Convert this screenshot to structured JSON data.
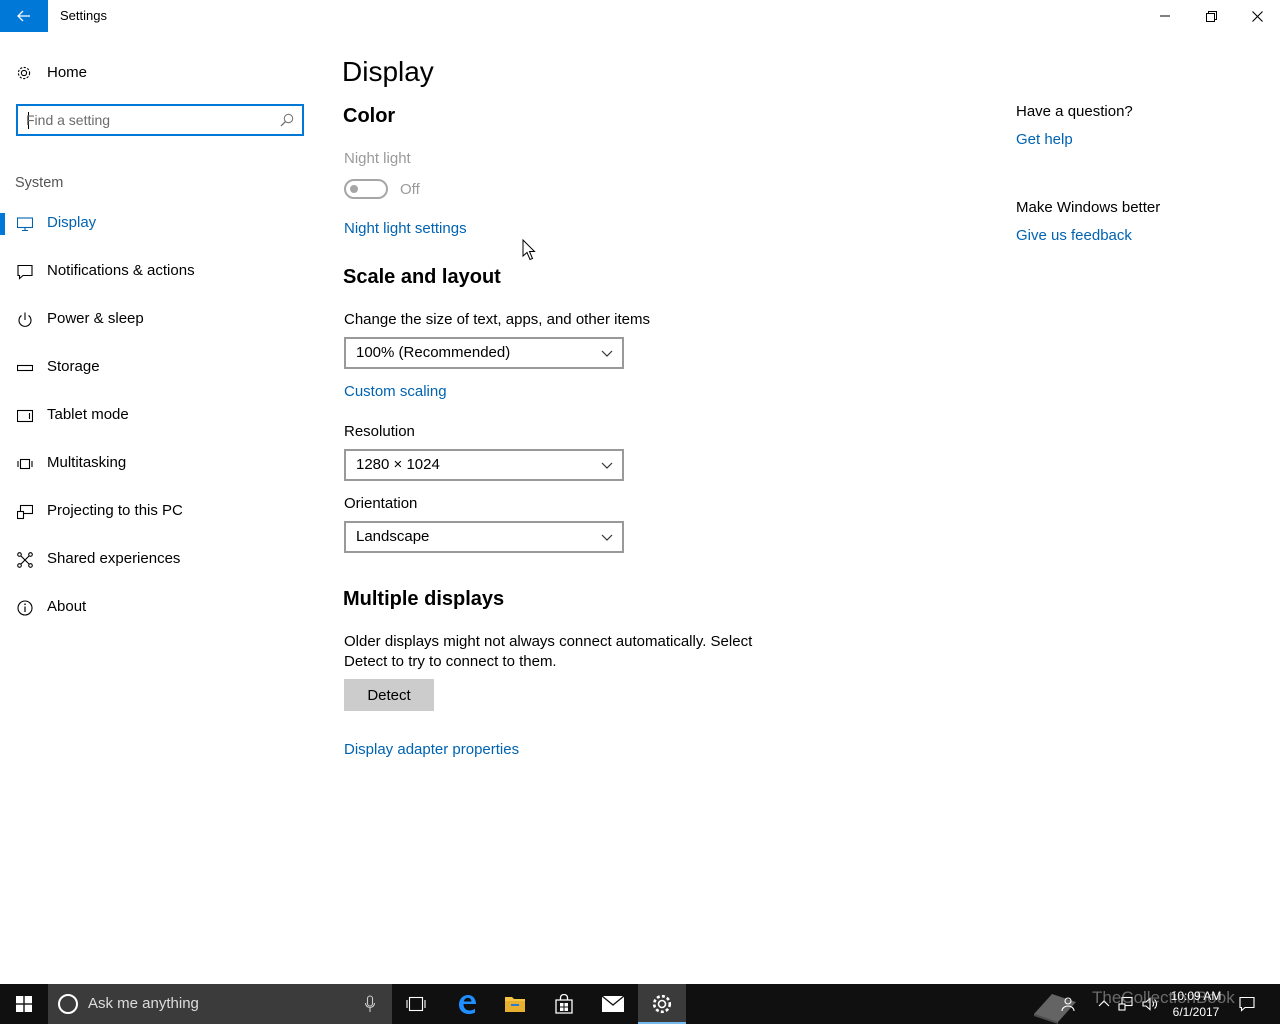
{
  "window": {
    "title": "Settings"
  },
  "sidebar": {
    "home_label": "Home",
    "search_placeholder": "Find a setting",
    "group_label": "System",
    "items": [
      {
        "label": "Display",
        "icon": "monitor-icon",
        "active": true
      },
      {
        "label": "Notifications & actions",
        "icon": "message-icon"
      },
      {
        "label": "Power & sleep",
        "icon": "power-icon"
      },
      {
        "label": "Storage",
        "icon": "storage-icon"
      },
      {
        "label": "Tablet mode",
        "icon": "tablet-icon"
      },
      {
        "label": "Multitasking",
        "icon": "multitasking-icon"
      },
      {
        "label": "Projecting to this PC",
        "icon": "projecting-icon"
      },
      {
        "label": "Shared experiences",
        "icon": "shared-icon"
      },
      {
        "label": "About",
        "icon": "info-icon"
      }
    ]
  },
  "main": {
    "page_title": "Display",
    "color": {
      "heading": "Color",
      "night_light_label": "Night light",
      "night_light_state": "Off",
      "night_light_settings_link": "Night light settings"
    },
    "scale": {
      "heading": "Scale and layout",
      "size_label": "Change the size of text, apps, and other items",
      "size_value": "100% (Recommended)",
      "custom_scaling_link": "Custom scaling",
      "resolution_label": "Resolution",
      "resolution_value": "1280 × 1024",
      "orientation_label": "Orientation",
      "orientation_value": "Landscape"
    },
    "multiple": {
      "heading": "Multiple displays",
      "description": "Older displays might not always connect automatically. Select Detect to try to connect to them.",
      "detect_button": "Detect",
      "adapter_link": "Display adapter properties"
    }
  },
  "help": {
    "question_heading": "Have a question?",
    "get_help_link": "Get help",
    "feedback_heading": "Make Windows better",
    "feedback_link": "Give us feedback"
  },
  "taskbar": {
    "search_text": "Ask me anything",
    "time": "10:09 AM",
    "date": "6/1/2017",
    "watermark": "TheCollectionBook",
    "accent_color": "#0078d7"
  }
}
